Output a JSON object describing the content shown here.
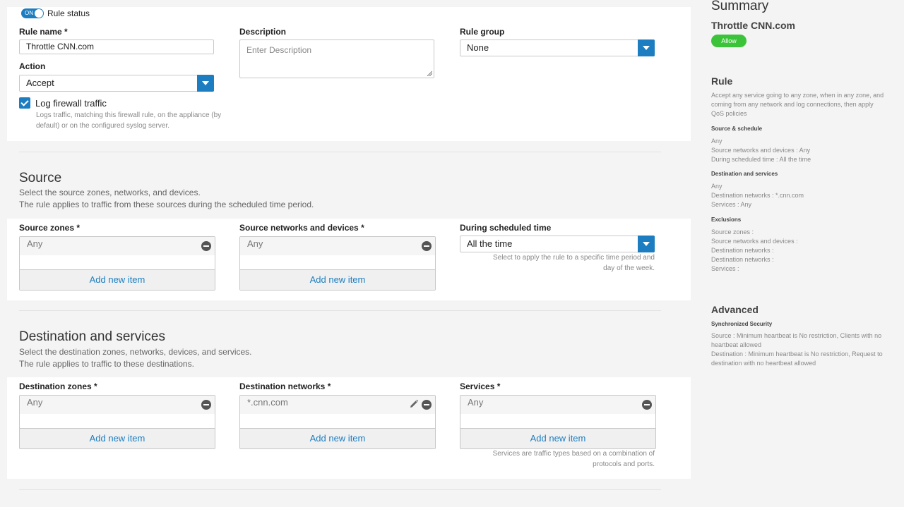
{
  "rule_status": {
    "toggle_text": "ON",
    "label": "Rule status"
  },
  "rule_name": {
    "label": "Rule name *",
    "value": "Throttle CNN.com"
  },
  "description": {
    "label": "Description",
    "placeholder": "Enter Description"
  },
  "rule_group": {
    "label": "Rule group",
    "value": "None"
  },
  "action": {
    "label": "Action",
    "value": "Accept"
  },
  "log_firewall": {
    "label": "Log firewall traffic",
    "help_line1": "Logs traffic, matching this firewall rule, on the appliance (by",
    "help_line2": "default) or on the configured syslog server."
  },
  "source": {
    "title": "Source",
    "sub1": "Select the source zones, networks, and devices.",
    "sub2": "The rule applies to traffic from these sources during the scheduled time period.",
    "zones": {
      "label": "Source zones *",
      "item": "Any",
      "add": "Add new item"
    },
    "networks": {
      "label": "Source networks and devices *",
      "item": "Any",
      "add": "Add new item"
    },
    "schedule": {
      "label": "During scheduled time",
      "value": "All the time",
      "help_line1": "Select to apply the rule to a specific time period and",
      "help_line2": "day of the week."
    }
  },
  "destination": {
    "title": "Destination and services",
    "sub1": "Select the destination zones, networks, devices, and services.",
    "sub2": "The rule applies to traffic to these destinations.",
    "zones": {
      "label": "Destination zones *",
      "item": "Any",
      "add": "Add new item"
    },
    "networks": {
      "label": "Destination networks *",
      "item": "*.cnn.com",
      "add": "Add new item"
    },
    "services": {
      "label": "Services *",
      "item": "Any",
      "add": "Add new item",
      "help_line1": "Services are traffic types based on a combination of",
      "help_line2": "protocols and ports."
    }
  },
  "summary": {
    "title": "Summary",
    "rule_name": "Throttle CNN.com",
    "badge": "Allow",
    "badge_color": "#3bc439",
    "rule_heading": "Rule",
    "rule_desc_1": "Accept any service going to any zone, when in any zone, and",
    "rule_desc_2": "coming from any network and log connections, then apply",
    "rule_desc_3": "QoS policies",
    "source_schedule_heading": "Source & schedule",
    "source_schedule_lines": [
      "Any",
      "Source networks and devices : Any",
      "During scheduled time : All the time"
    ],
    "dest_services_heading": "Destination and services",
    "dest_services_lines": [
      "Any",
      "Destination networks : *.cnn.com",
      "Services : Any"
    ],
    "exclusions_heading": "Exclusions",
    "exclusions_lines": [
      "Source zones :",
      "Source networks and devices :",
      "Destination networks :",
      "Destination networks :",
      "Services :"
    ],
    "advanced_heading": "Advanced",
    "sync_heading": "Synchronized Security",
    "sync_line1": "Source : Minimum heartbeat is No restriction, Clients with no",
    "sync_line2": "heartbeat allowed",
    "sync_line3": "Destination : Minimum heartbeat is No restriction, Request to",
    "sync_line4": "destination with no heartbeat allowed"
  },
  "colors": {
    "accent": "#1c7ec0",
    "allow": "#3bc439"
  }
}
